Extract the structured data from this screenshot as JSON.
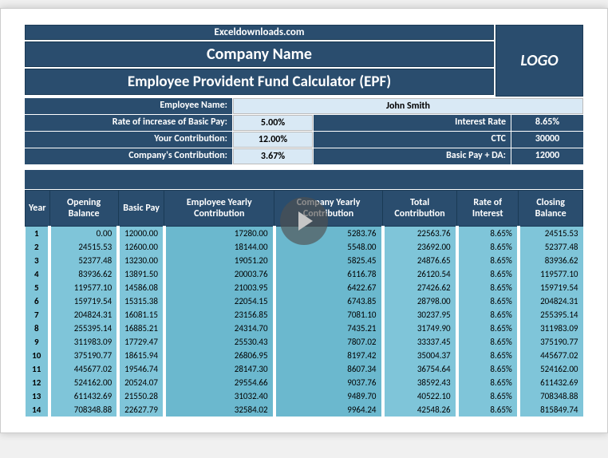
{
  "header": {
    "site": "Exceldownloads.com",
    "company": "Company Name",
    "title": "Employee Provident Fund Calculator (EPF)",
    "logo": "LOGO"
  },
  "info": {
    "employee_name_label": "Employee Name:",
    "employee_name": "John Smith",
    "rate_increase_label": "Rate of increase of Basic Pay:",
    "rate_increase": "5.00%",
    "interest_rate_label": "Interest Rate",
    "interest_rate": "8.65%",
    "your_contrib_label": "Your Contribution:",
    "your_contrib": "12.00%",
    "ctc_label": "CTC",
    "ctc": "30000",
    "company_contrib_label": "Company's Contribution:",
    "company_contrib": "3.67%",
    "basic_pay_da_label": "Basic Pay + DA:",
    "basic_pay_da": "12000"
  },
  "columns": {
    "year": "Year",
    "opening": "Opening Balance",
    "basic": "Basic Pay",
    "emp_yearly": "Employee Yearly Contribution",
    "comp_yearly": "Company Yearly Contribution",
    "total": "Total Contribution",
    "roi": "Rate of Interest",
    "closing": "Closing Balance"
  },
  "rows": [
    {
      "year": "1",
      "opening": "0.00",
      "basic": "12000.00",
      "emp": "17280.00",
      "comp": "5283.76",
      "total": "22563.76",
      "roi": "8.65%",
      "closing": "24515.53"
    },
    {
      "year": "2",
      "opening": "24515.53",
      "basic": "12600.00",
      "emp": "18144.00",
      "comp": "5548.00",
      "total": "23692.00",
      "roi": "8.65%",
      "closing": "52377.48"
    },
    {
      "year": "3",
      "opening": "52377.48",
      "basic": "13230.00",
      "emp": "19051.20",
      "comp": "5825.45",
      "total": "24876.65",
      "roi": "8.65%",
      "closing": "83936.62"
    },
    {
      "year": "4",
      "opening": "83936.62",
      "basic": "13891.50",
      "emp": "20003.76",
      "comp": "6116.78",
      "total": "26120.54",
      "roi": "8.65%",
      "closing": "119577.10"
    },
    {
      "year": "5",
      "opening": "119577.10",
      "basic": "14586.08",
      "emp": "21003.95",
      "comp": "6422.67",
      "total": "27426.62",
      "roi": "8.65%",
      "closing": "159719.54"
    },
    {
      "year": "6",
      "opening": "159719.54",
      "basic": "15315.38",
      "emp": "22054.15",
      "comp": "6743.85",
      "total": "28798.00",
      "roi": "8.65%",
      "closing": "204824.31"
    },
    {
      "year": "7",
      "opening": "204824.31",
      "basic": "16081.15",
      "emp": "23156.85",
      "comp": "7081.10",
      "total": "30237.95",
      "roi": "8.65%",
      "closing": "255395.14"
    },
    {
      "year": "8",
      "opening": "255395.14",
      "basic": "16885.21",
      "emp": "24314.70",
      "comp": "7435.21",
      "total": "31749.90",
      "roi": "8.65%",
      "closing": "311983.09"
    },
    {
      "year": "9",
      "opening": "311983.09",
      "basic": "17729.47",
      "emp": "25530.43",
      "comp": "7807.02",
      "total": "33337.45",
      "roi": "8.65%",
      "closing": "375190.77"
    },
    {
      "year": "10",
      "opening": "375190.77",
      "basic": "18615.94",
      "emp": "26806.95",
      "comp": "8197.42",
      "total": "35004.37",
      "roi": "8.65%",
      "closing": "445677.02"
    },
    {
      "year": "11",
      "opening": "445677.02",
      "basic": "19546.74",
      "emp": "28147.30",
      "comp": "8607.34",
      "total": "36754.64",
      "roi": "8.65%",
      "closing": "524162.00"
    },
    {
      "year": "12",
      "opening": "524162.00",
      "basic": "20524.07",
      "emp": "29554.66",
      "comp": "9037.76",
      "total": "38592.43",
      "roi": "8.65%",
      "closing": "611432.69"
    },
    {
      "year": "13",
      "opening": "611432.69",
      "basic": "21550.28",
      "emp": "31032.40",
      "comp": "9489.70",
      "total": "40522.10",
      "roi": "8.65%",
      "closing": "708348.88"
    },
    {
      "year": "14",
      "opening": "708348.88",
      "basic": "22627.79",
      "emp": "32584.02",
      "comp": "9964.24",
      "total": "42548.26",
      "roi": "8.65%",
      "closing": "815849.74"
    }
  ]
}
